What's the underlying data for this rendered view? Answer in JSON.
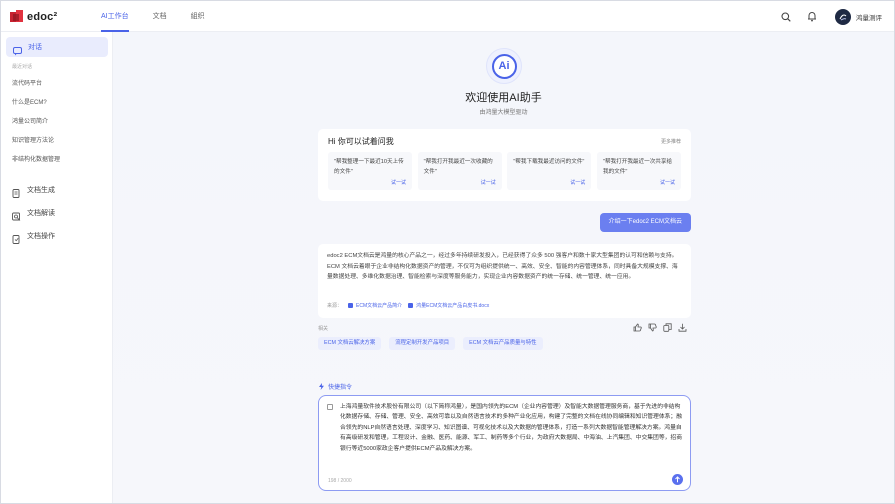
{
  "brand": {
    "name": "edoc²"
  },
  "nav": {
    "tabs": [
      "AI工作台",
      "文档",
      "組织"
    ],
    "active": 0
  },
  "user": {
    "name": "鸿量测评"
  },
  "sidebar": {
    "chat_label": "对话",
    "section_label": "最近对话",
    "recent": [
      "流代码平台",
      "什么是ECM?",
      "鸿量公司简介",
      "知识管理方法论",
      "非结构化数据管理"
    ],
    "tools": [
      {
        "label": "文档生成",
        "icon": "doc-generate-icon"
      },
      {
        "label": "文档解读",
        "icon": "doc-read-icon"
      },
      {
        "label": "文档操作",
        "icon": "doc-operate-icon"
      }
    ]
  },
  "hero": {
    "badge": "Ai",
    "title": "欢迎使用AI助手",
    "subtitle": "由鸿量大模型驱动"
  },
  "suggest": {
    "title": "Hi 你可以试着问我",
    "more": "更多推荐",
    "try_label": "试一试",
    "items": [
      "\"帮我整理一下最近10天上传的文件\"",
      "\"帮我打开我最近一次收藏的文件\"",
      "\"帮我下载我最近访问的文件\"",
      "\"帮我打开我最近一次共享给我的文件\""
    ]
  },
  "conversation": {
    "question": "介绍一下edoc2 ECM文档云",
    "answer": "edoc2 ECM文档云是鸿量的核心产品之一，经过多年持续研发投入，已经获得了众多 500 强客户和数十家大型集团的认可和信赖与支持。ECM 文档云着眼于企业非结构化数据资产的管理，不仅可为组织提供统一、高效、安全、智能的内容管理体系，同时具备大规模支撑、海量数据处理、多维化数据治理、智能检索与深度等服务能力，实现企业内容数据资产的统一存储、统一管理、统一应用。",
    "source_label": "来源：",
    "sources": [
      "ECM文档云产品简介",
      "鸿量ECM文档云产品白皮书.docx"
    ],
    "related_label": "相关",
    "related": [
      "ECM 文档云解决方案",
      "流程定制开发产品项目",
      "ECM 文档云产品质量与特性"
    ]
  },
  "quick": {
    "label": "快捷指令"
  },
  "input": {
    "value": "上海鸿量软件技术股份有限公司（以下简称鸿量），是国内领先的ECM（企业内容管理）及智能大数据管理服务商，基于先进的非结构化数据存储、存储、管理、安全、高效可靠以及自然语言技术的多种产业化应用，构建了完整的文档在线协同编辑和知识管理体系；融合领先的NLP自然语言处理、深度学习、知识图谱、可视化技术以及大数据的管理体系，打造一系列大数据智能管理解决方案。鸿量自有高级研发和管理，工程设计、金融、医药、能源、军工、制药等多个行业，为政府大数据局、中海油、上汽集团、中交集团等，招商银行等近5000家政企客户提供ECM产品及解决方案。",
    "count": "198 / 2000"
  }
}
